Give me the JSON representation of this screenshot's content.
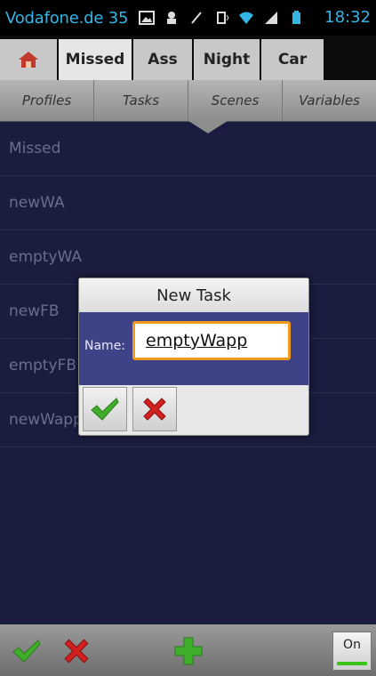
{
  "status_bar": {
    "carrier": "Vodafone.de 35",
    "time": "18:32",
    "icons": [
      "image-icon",
      "notification-icon",
      "usb-icon",
      "vibrate-icon",
      "wifi-icon",
      "signal-icon",
      "battery-icon"
    ]
  },
  "profile_tabs": [
    {
      "icon": "home-icon"
    },
    {
      "label": "Missed",
      "active": true
    },
    {
      "label": "Ass"
    },
    {
      "label": "Night"
    },
    {
      "label": "Car"
    }
  ],
  "section_tabs": [
    {
      "label": "Profiles"
    },
    {
      "label": "Tasks",
      "active": true
    },
    {
      "label": "Scenes"
    },
    {
      "label": "Variables"
    }
  ],
  "task_list": [
    {
      "label": "Missed"
    },
    {
      "label": "newWA"
    },
    {
      "label": "emptyWA"
    },
    {
      "label": "newFB"
    },
    {
      "label": "emptyFB"
    },
    {
      "label": "newWapp"
    }
  ],
  "dialog": {
    "title": "New Task",
    "name_label": "Name:",
    "name_value": "emptyWapp",
    "ok_icon": "checkmark-icon",
    "cancel_icon": "x-icon"
  },
  "bottom_bar": {
    "accept_icon": "checkmark-icon",
    "cancel_icon": "x-icon",
    "add_icon": "plus-icon",
    "toggle_label": "On"
  },
  "colors": {
    "accent": "#34b5e5",
    "list_bg": "#1a1d3f",
    "dialog_body": "#3e4286",
    "input_focus": "#f09a1c",
    "toggle_led": "#39c41a"
  }
}
